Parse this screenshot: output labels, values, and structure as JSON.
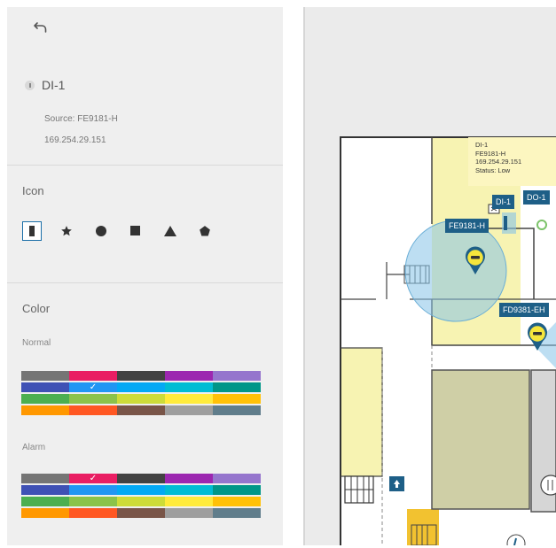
{
  "device": {
    "name": "DI-1",
    "source": "Source: FE9181-H",
    "ip": "169.254.29.151"
  },
  "icon_section": {
    "title": "Icon",
    "options": [
      {
        "name": "bar-icon",
        "selected": true
      },
      {
        "name": "star-icon",
        "selected": false
      },
      {
        "name": "circle-icon",
        "selected": false
      },
      {
        "name": "square-icon",
        "selected": false
      },
      {
        "name": "triangle-icon",
        "selected": false
      },
      {
        "name": "pentagon-icon",
        "selected": false
      }
    ]
  },
  "color_section": {
    "title": "Color",
    "normal_label": "Normal",
    "alarm_label": "Alarm",
    "swatches": [
      "#757575",
      "#e91e63",
      "#424242",
      "#9c27b0",
      "#9575cd",
      "#3f51b5",
      "#2196f3",
      "#03a9f4",
      "#00bcd4",
      "#009688",
      "#4caf50",
      "#8bc34a",
      "#cddc39",
      "#ffeb3b",
      "#ffc107",
      "#ff9800",
      "#ff5722",
      "#795548",
      "#9e9e9e",
      "#607d8b"
    ],
    "normal_selected_index": 6,
    "alarm_selected_index": 1
  },
  "tooltip": {
    "line1": "DI-1",
    "line2": "FE9181-H",
    "line3": "169.254.29.151",
    "line4": "Status: Low"
  },
  "map_labels": {
    "di1": "DI-1",
    "do1": "DO-1",
    "cam1": "FE9181-H",
    "cam2": "FD9381-EH"
  },
  "colors": {
    "label_bg": "#1e5f87",
    "camera_yellow": "#f5e53c",
    "room_yellow": "#f7f3b2",
    "room_olive": "#cfcfa6",
    "coverage_blue": "#86c3e8",
    "selected_border": "#1b6fa8"
  }
}
